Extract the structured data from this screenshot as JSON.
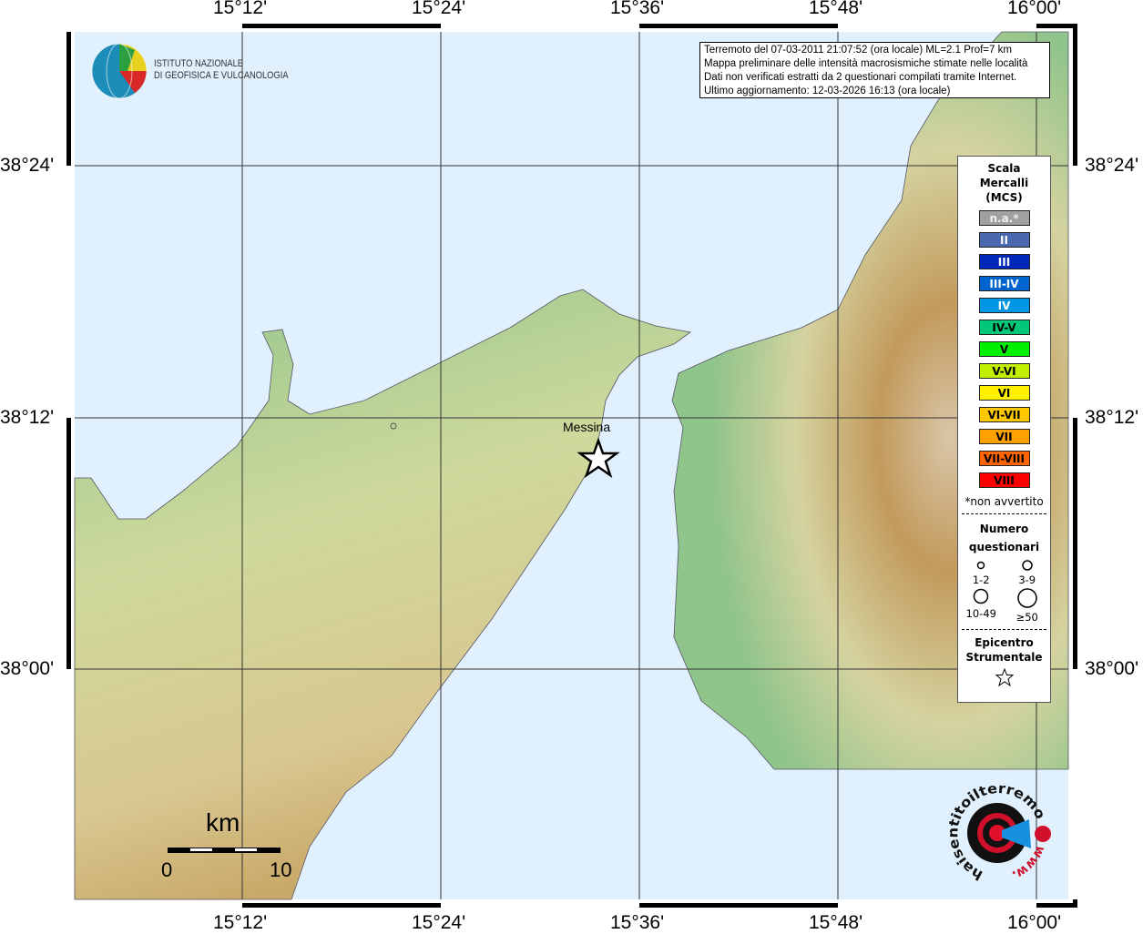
{
  "lon_ticks": [
    "15°12'",
    "15°24'",
    "15°36'",
    "15°48'",
    "16°00'"
  ],
  "lat_ticks": [
    "38°24'",
    "38°12'",
    "38°00'"
  ],
  "info": {
    "lines": [
      "Terremoto del 07-03-2011 21:07:52 (ora locale) ML=2.1 Prof=7 km",
      "Mappa preliminare delle intensità macrosismiche stimate nelle località",
      "Dati non verificati estratti da 2 questionari compilati tramite Internet.",
      "Ultimo aggiornamento: 12-03-2026 16:13 (ora locale)"
    ]
  },
  "logo": {
    "line1": "ISTITUTO NAZIONALE",
    "line2": "DI GEOFISICA E VULCANOLOGIA"
  },
  "city": "Messina",
  "scale": {
    "unit": "km",
    "min": "0",
    "max": "10"
  },
  "legend": {
    "title": [
      "Scala",
      "Mercalli",
      "(MCS)"
    ],
    "classes": [
      {
        "label": "n.a.*",
        "color": "#a0a0a0",
        "text": "#eee"
      },
      {
        "label": "II",
        "color": "#4a68b0",
        "text": "#fff"
      },
      {
        "label": "III",
        "color": "#0028b8",
        "text": "#fff"
      },
      {
        "label": "III-IV",
        "color": "#0064d0",
        "text": "#fff"
      },
      {
        "label": "IV",
        "color": "#0096e6",
        "text": "#fff"
      },
      {
        "label": "IV-V",
        "color": "#00c878",
        "text": "#000"
      },
      {
        "label": "V",
        "color": "#00f000",
        "text": "#000"
      },
      {
        "label": "V-VI",
        "color": "#c0f000",
        "text": "#000"
      },
      {
        "label": "VI",
        "color": "#fff000",
        "text": "#000"
      },
      {
        "label": "VI-VII",
        "color": "#ffc800",
        "text": "#000"
      },
      {
        "label": "VII",
        "color": "#ffa000",
        "text": "#000"
      },
      {
        "label": "VII-VIII",
        "color": "#ff6400",
        "text": "#000"
      },
      {
        "label": "VIII",
        "color": "#ff0000",
        "text": "#000"
      }
    ],
    "na_note": "*non avvertito",
    "num_title": [
      "Numero",
      "questionari"
    ],
    "num": [
      "1-2",
      "3-9",
      "10-49",
      "≥50"
    ],
    "epi_title": [
      "Epicentro",
      "Strumentale"
    ]
  },
  "hst": {
    "text": "haisentitoilterremoto.it",
    "www": "www."
  }
}
